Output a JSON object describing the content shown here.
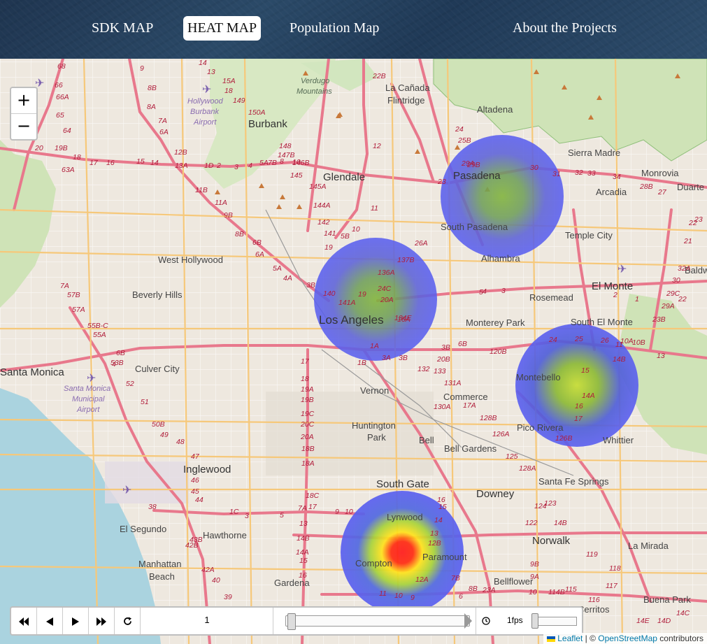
{
  "nav": {
    "items": [
      {
        "label": "SDK MAP",
        "active": false
      },
      {
        "label": "HEAT MAP",
        "active": true
      },
      {
        "label": "Population Map",
        "active": false
      },
      {
        "label": "About the Projects",
        "active": false
      }
    ]
  },
  "map": {
    "zoom_in": "+",
    "zoom_out": "−",
    "place_labels": {
      "burbank": "Burbank",
      "glendale": "Glendale",
      "pasadena": "Pasadena",
      "altadena": "Altadena",
      "la_canada": "La Cañada",
      "flintridge": "Flintridge",
      "verdugo": "Verdugo",
      "mountains": "Mountains",
      "sierra_madre": "Sierra Madre",
      "monrovia": "Monrovia",
      "duarte": "Duarte",
      "arcadia": "Arcadia",
      "temple_city": "Temple City",
      "south_pasadena": "South Pasadena",
      "alhambra": "Alhambra",
      "west_hollywood": "West Hollywood",
      "beverly_hills": "Beverly Hills",
      "los_angeles": "Los Angeles",
      "el_monte": "El Monte",
      "rosemead": "Rosemead",
      "monterey_park": "Monterey Park",
      "south_el_monte": "South El Monte",
      "baldwin": "Baldw",
      "santa_monica": "Santa Monica",
      "culver_city": "Culver City",
      "vernon": "Vernon",
      "commerce": "Commerce",
      "montebello": "Montebello",
      "huntington": "Huntington",
      "park": "Park",
      "bell": "Bell",
      "bell_gardens": "Bell Gardens",
      "pico_rivera": "Pico Rivera",
      "whittier": "Whittier",
      "inglewood": "Inglewood",
      "south_gate": "South Gate",
      "downey": "Downey",
      "santa_fe_springs": "Santa Fe Springs",
      "lynwood": "Lynwood",
      "paramount": "Paramount",
      "compton": "Compton",
      "el_segundo": "El Segundo",
      "hawthorne": "Hawthorne",
      "manhattan": "Manhattan",
      "beach": "Beach",
      "gardena": "Gardena",
      "norwalk": "Norwalk",
      "la_mirada": "La Mirada",
      "bellflower": "Bellflower",
      "buena_park": "Buena Park",
      "cerritos": "Cerritos"
    },
    "airport_labels": {
      "hollywood": "Hollywood",
      "burbank": "Burbank",
      "airport": "Airport",
      "santa_monica": "Santa Monica",
      "municipal": "Municipal"
    },
    "highway_labels": [
      "68",
      "66",
      "66A",
      "65",
      "64",
      "20",
      "19B",
      "63A",
      "18",
      "17",
      "16",
      "15",
      "14",
      "13A",
      "1D",
      "2",
      "3",
      "4",
      "5A",
      "7B",
      "8",
      "10",
      "9",
      "8B",
      "8A",
      "7A",
      "6A",
      "12B",
      "11B",
      "11A",
      "9B",
      "8B",
      "6B",
      "6A",
      "5A",
      "4A",
      "3B",
      "140",
      "141A",
      "141",
      "142",
      "144A",
      "145A",
      "145",
      "146B",
      "147B",
      "148",
      "150A",
      "149",
      "18",
      "15A",
      "14",
      "13",
      "12",
      "11",
      "10",
      "5B",
      "19",
      "22B",
      "23",
      "24",
      "25B",
      "29A",
      "29B",
      "30",
      "31",
      "32",
      "33",
      "34",
      "28B",
      "27",
      "26A",
      "137B",
      "136A",
      "24C",
      "20A",
      "19",
      "134E",
      "16A",
      "1A",
      "1B",
      "3A",
      "3B",
      "4",
      "6B",
      "7A",
      "57B",
      "57A",
      "55B-C",
      "55A",
      "53B",
      "52",
      "51",
      "50B",
      "49",
      "48",
      "47",
      "46",
      "45",
      "44",
      "43B",
      "42B",
      "42A",
      "40",
      "39",
      "38",
      "1C",
      "3",
      "5",
      "7A",
      "9",
      "10",
      "13",
      "14B",
      "14A",
      "15",
      "16",
      "17",
      "18",
      "19A",
      "19B",
      "19C",
      "20C",
      "20A",
      "18B",
      "18A",
      "18C",
      "17",
      "16",
      "15",
      "14",
      "13",
      "12B",
      "12A",
      "11",
      "10",
      "9",
      "8B",
      "7B",
      "6",
      "5",
      "4",
      "3",
      "2",
      "1",
      "22",
      "23B",
      "29A",
      "29C",
      "30",
      "32A",
      "21",
      "22",
      "23",
      "24",
      "25",
      "26",
      "10A",
      "10B",
      "11",
      "13",
      "14B",
      "15",
      "14A",
      "16",
      "17",
      "126B",
      "126A",
      "125",
      "128A",
      "128B",
      "130A",
      "17A",
      "131A",
      "132",
      "133",
      "20B",
      "3B",
      "6B",
      "120B",
      "119",
      "118",
      "117",
      "116",
      "115",
      "114B",
      "10",
      "9A",
      "9B",
      "122",
      "123",
      "124",
      "14B",
      "14C",
      "14D",
      "14E",
      "23A",
      "23B",
      "24"
    ],
    "heat_points": [
      {
        "id": "pasadena",
        "intensity": 0.35
      },
      {
        "id": "downtown",
        "intensity": 0.45
      },
      {
        "id": "montebello",
        "intensity": 0.6
      },
      {
        "id": "compton",
        "intensity": 1.0
      }
    ]
  },
  "timeline": {
    "current": "1",
    "fps": "1fps"
  },
  "attribution": {
    "leaflet": "Leaflet",
    "sep": " | © ",
    "osm": "OpenStreetMap",
    "suffix": " contributors"
  }
}
